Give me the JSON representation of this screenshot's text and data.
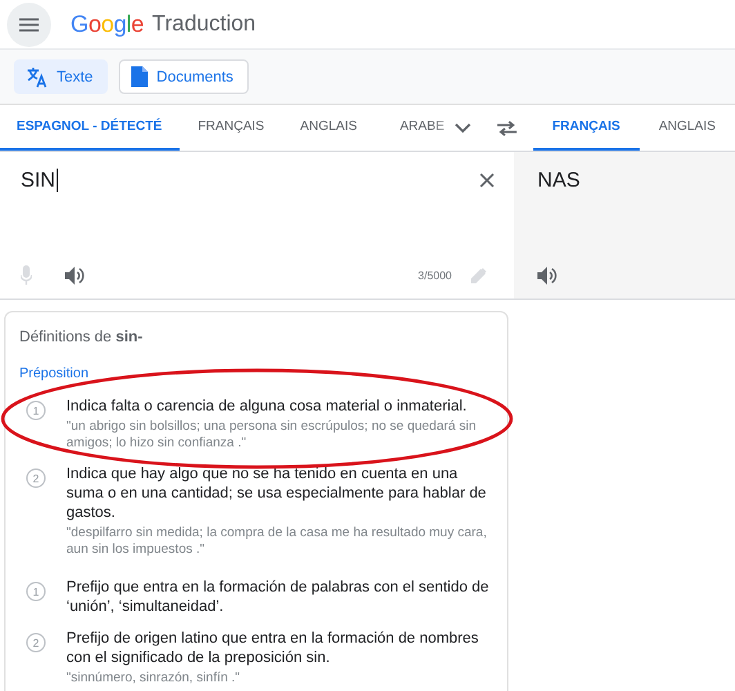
{
  "header": {
    "logo": "Google",
    "product": "Traduction"
  },
  "modes": [
    {
      "label": "Texte",
      "selected": true
    },
    {
      "label": "Documents",
      "selected": false
    }
  ],
  "source_languages": [
    {
      "label": "ESPAGNOL - DÉTECTÉ",
      "selected": true,
      "faded": false
    },
    {
      "label": "FRANÇAIS",
      "selected": false,
      "faded": false
    },
    {
      "label": "ANGLAIS",
      "selected": false,
      "faded": false
    },
    {
      "label": "ARABE",
      "selected": false,
      "faded": true
    }
  ],
  "target_languages": [
    {
      "label": "FRANÇAIS",
      "selected": true
    },
    {
      "label": "ANGLAIS",
      "selected": false
    }
  ],
  "source": {
    "value": "SIN",
    "counter": "3/5000"
  },
  "target": {
    "value": "NAS"
  },
  "definitions": {
    "title": "Définitions de **sin-**",
    "groups": [
      {
        "heading": "Préposition",
        "items": [
          {
            "number": "1",
            "text": "Indica falta o carencia de alguna cosa material o inmaterial.",
            "example": "\"un abrigo sin bolsillos; una persona sin escrúpulos; no se quedará sin amigos; lo hizo sin confianza .\""
          },
          {
            "number": "2",
            "text": "Indica que hay algo que no se ha tenido en cuenta en una suma o en una cantidad; se usa especialmente para hablar de gastos.",
            "example": "\"despilfarro sin medida; la compra de la casa me ha resultado muy cara, aun sin los impuestos .\""
          }
        ]
      },
      {
        "items": [
          {
            "number": "1",
            "text": "Prefijo que entra en la formación de palabras con el sentido de ‘unión’, ‘simultaneidad’."
          },
          {
            "number": "2",
            "text": "Prefijo de origen latino que entra en la formación de nombres con el significado de la preposición sin.",
            "example": "\"sinnúmero, sinrazón, sinfín .\""
          }
        ]
      }
    ]
  }
}
